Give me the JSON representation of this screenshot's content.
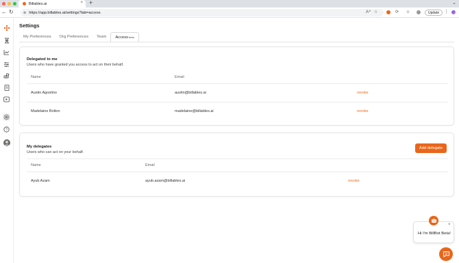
{
  "browser": {
    "tab_title": "Billables.ai",
    "tab_close": "×",
    "new_tab": "+",
    "url": "https://app.billables.ai/settings?tab=access",
    "update_label": "Update",
    "more": "⋮"
  },
  "page": {
    "title": "Settings",
    "tabs": [
      {
        "label": "My Preferences"
      },
      {
        "label": "Org Preferences"
      },
      {
        "label": "Team"
      },
      {
        "label": "Access",
        "badge": "beta"
      }
    ]
  },
  "delegated_to_me": {
    "title": "Delegated to me",
    "subtitle": "Users who have granted you access to act on their behalf.",
    "columns": [
      "Name",
      "Email"
    ],
    "rows": [
      {
        "name": "Austin Agostino",
        "email": "austin@billables.ai",
        "action": "revoke"
      },
      {
        "name": "Madelaine Bolton",
        "email": "madelaine@billables.ai",
        "action": "revoke"
      }
    ]
  },
  "my_delegates": {
    "title": "My delegates",
    "subtitle": "Users who can act on your behalf.",
    "add_button": "Add delegate",
    "columns": [
      "Name",
      "Email"
    ],
    "rows": [
      {
        "name": "Ayub Azam",
        "email": "ayub.azam@billables.ai",
        "action": "revoke"
      }
    ]
  },
  "chat": {
    "greeting": "Hi I'm BillBot Beta!",
    "close": "×"
  },
  "colors": {
    "accent": "#e8671c"
  },
  "icons": {
    "rail": [
      "logo-icon",
      "hourglass-icon",
      "chart-icon",
      "sliders-icon",
      "blocks-icon",
      "document-icon",
      "play-icon",
      "settings-icon",
      "help-icon",
      "avatar"
    ]
  }
}
